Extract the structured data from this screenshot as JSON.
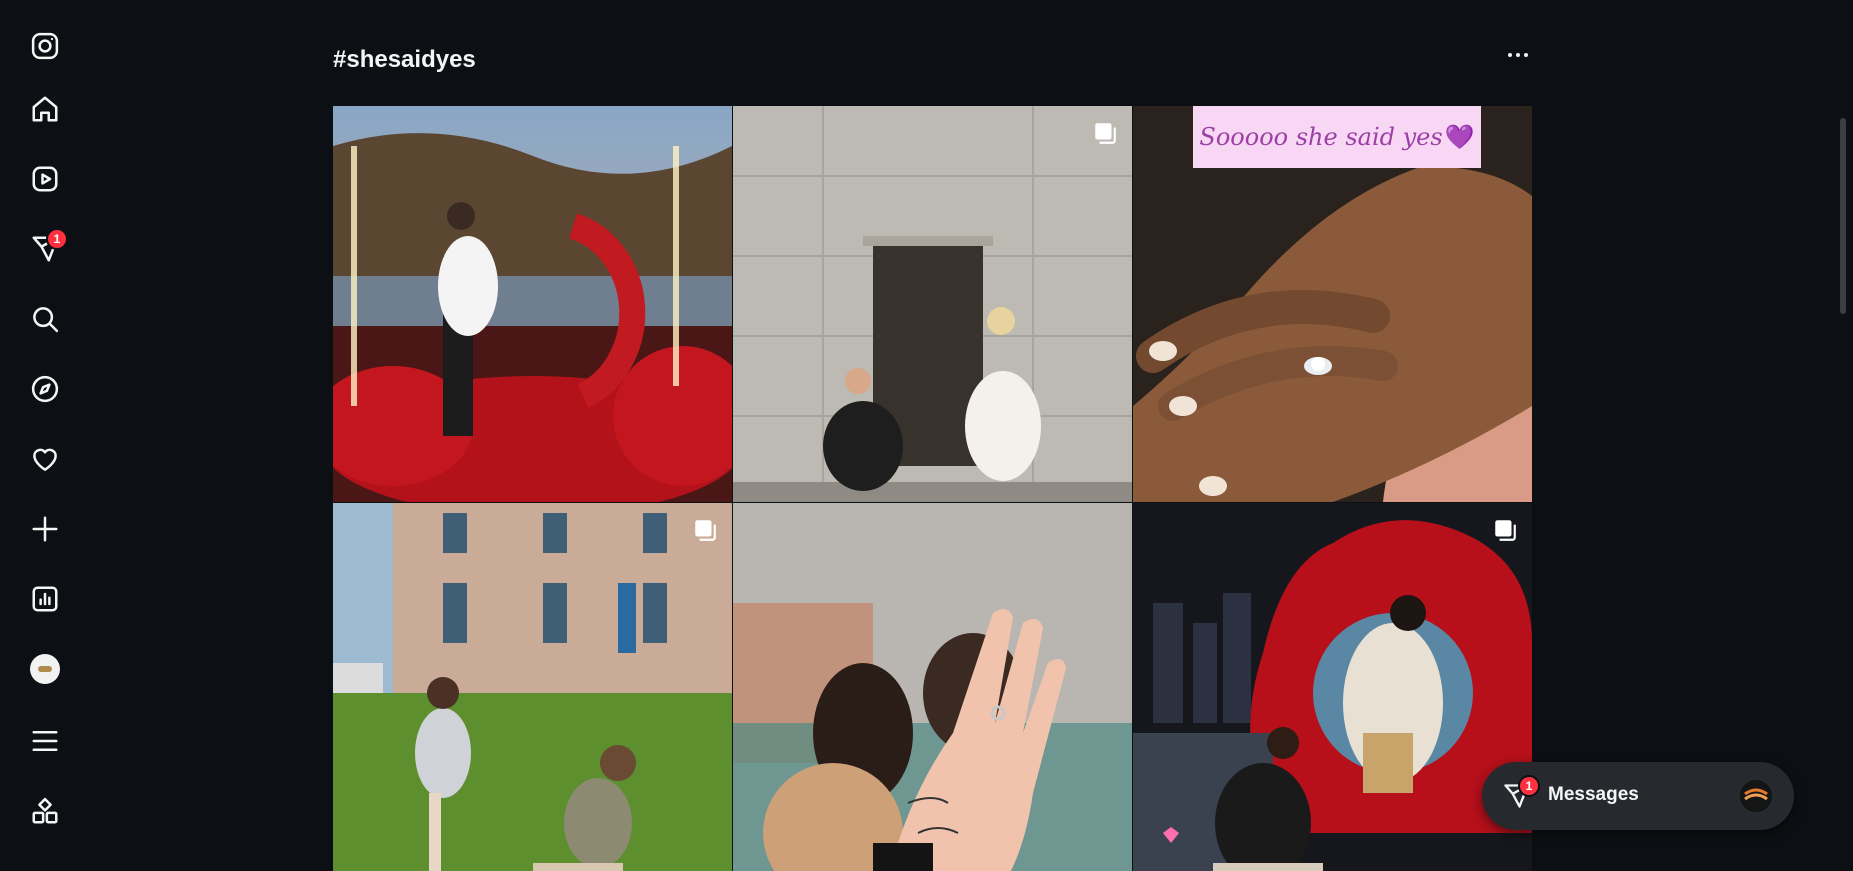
{
  "header": {
    "title": "#shesaidyes"
  },
  "sidebar": {
    "items": [
      {
        "name": "instagram-logo"
      },
      {
        "name": "home"
      },
      {
        "name": "reels"
      },
      {
        "name": "direct",
        "badge": "1"
      },
      {
        "name": "search"
      },
      {
        "name": "explore"
      },
      {
        "name": "notifications"
      },
      {
        "name": "create"
      },
      {
        "name": "dashboard"
      },
      {
        "name": "profile"
      },
      {
        "name": "more"
      },
      {
        "name": "also-from-meta"
      }
    ]
  },
  "grid": {
    "posts": [
      {
        "id": "post-1",
        "multi": false
      },
      {
        "id": "post-2",
        "multi": true
      },
      {
        "id": "post-3",
        "multi": false,
        "caption": "Sooooo she said yes",
        "caption_emoji": "💜"
      },
      {
        "id": "post-4",
        "multi": true
      },
      {
        "id": "post-5",
        "multi": false
      },
      {
        "id": "post-6",
        "multi": true
      }
    ]
  },
  "messages": {
    "label": "Messages",
    "badge": "1"
  },
  "colors": {
    "background": "#0c1014",
    "badge": "#ff3040",
    "pill": "#262a2f"
  }
}
